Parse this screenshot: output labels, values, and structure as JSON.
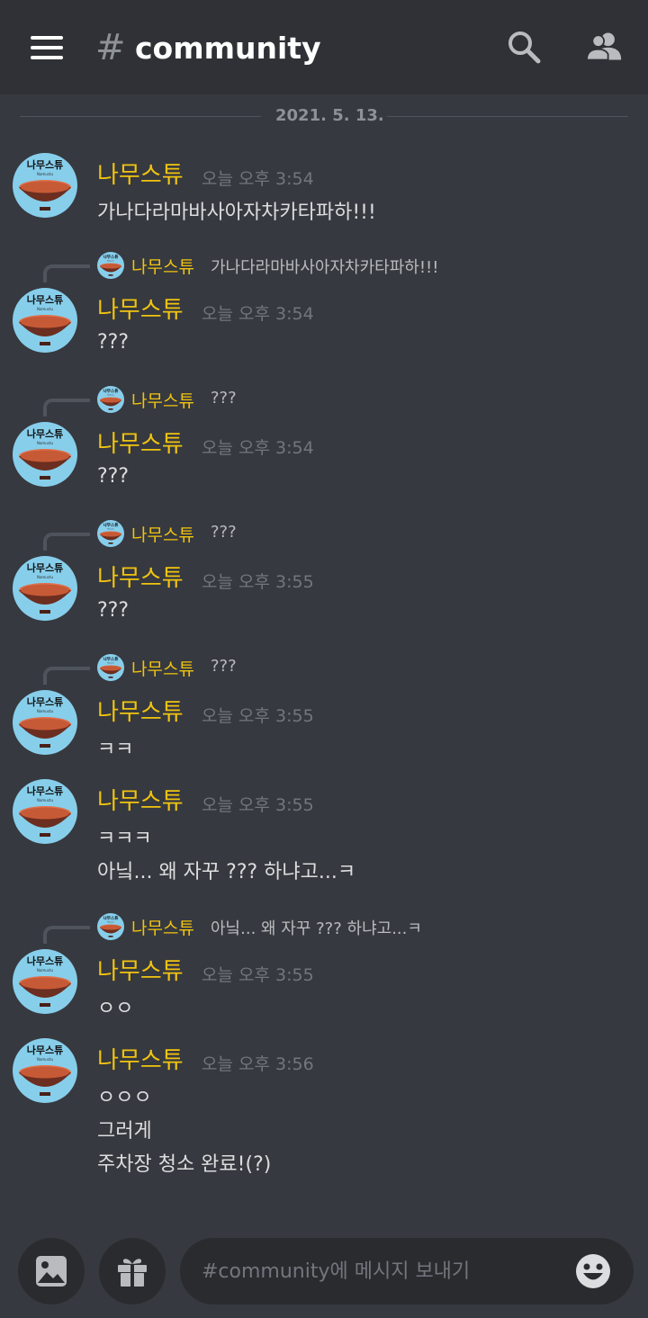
{
  "header": {
    "hash": "#",
    "channel_name": "community",
    "icons": [
      "menu-icon",
      "search-icon",
      "members-icon"
    ]
  },
  "date_divider": "2021. 5. 13.",
  "messages": [
    {
      "author": "나무스튜",
      "time": "오늘 오후 3:54",
      "lines": [
        "가나다라마바사아자차카타파하!!!"
      ]
    },
    {
      "reply_to": {
        "author": "나무스튜",
        "text": "가나다라마바사아자차카타파하!!!"
      },
      "author": "나무스튜",
      "time": "오늘 오후 3:54",
      "lines": [
        "???"
      ]
    },
    {
      "reply_to": {
        "author": "나무스튜",
        "text": "???"
      },
      "author": "나무스튜",
      "time": "오늘 오후 3:54",
      "lines": [
        "???"
      ]
    },
    {
      "reply_to": {
        "author": "나무스튜",
        "text": "???"
      },
      "author": "나무스튜",
      "time": "오늘 오후 3:55",
      "lines": [
        "???"
      ]
    },
    {
      "reply_to": {
        "author": "나무스튜",
        "text": "???"
      },
      "author": "나무스튜",
      "time": "오늘 오후 3:55",
      "lines": [
        "ㅋㅋ"
      ]
    },
    {
      "author": "나무스튜",
      "time": "오늘 오후 3:55",
      "lines": [
        "ㅋㅋㅋ",
        "아닠... 왜 자꾸 ??? 하냐고...ㅋ"
      ]
    },
    {
      "reply_to": {
        "author": "나무스튜",
        "text": "아닠... 왜 자꾸 ??? 하냐고...ㅋ"
      },
      "author": "나무스튜",
      "time": "오늘 오후 3:55",
      "lines": [
        "ㅇㅇ"
      ]
    },
    {
      "author": "나무스튜",
      "time": "오늘 오후 3:56",
      "lines": [
        "ㅇㅇㅇ",
        "그러게",
        "주차장 청소 완료!(?)"
      ]
    }
  ],
  "avatar_text": "나무스튜",
  "avatar_subtext": "Namustu",
  "composer": {
    "placeholder": "#community에 메시지 보내기",
    "buttons": [
      "image-icon",
      "gift-icon",
      "emoji-icon"
    ]
  },
  "colors": {
    "background": "#36393f",
    "header": "#2f3136",
    "author": "#f1c40f",
    "avatar_bg": "#87ceeb",
    "bowl": "#e0704a"
  }
}
